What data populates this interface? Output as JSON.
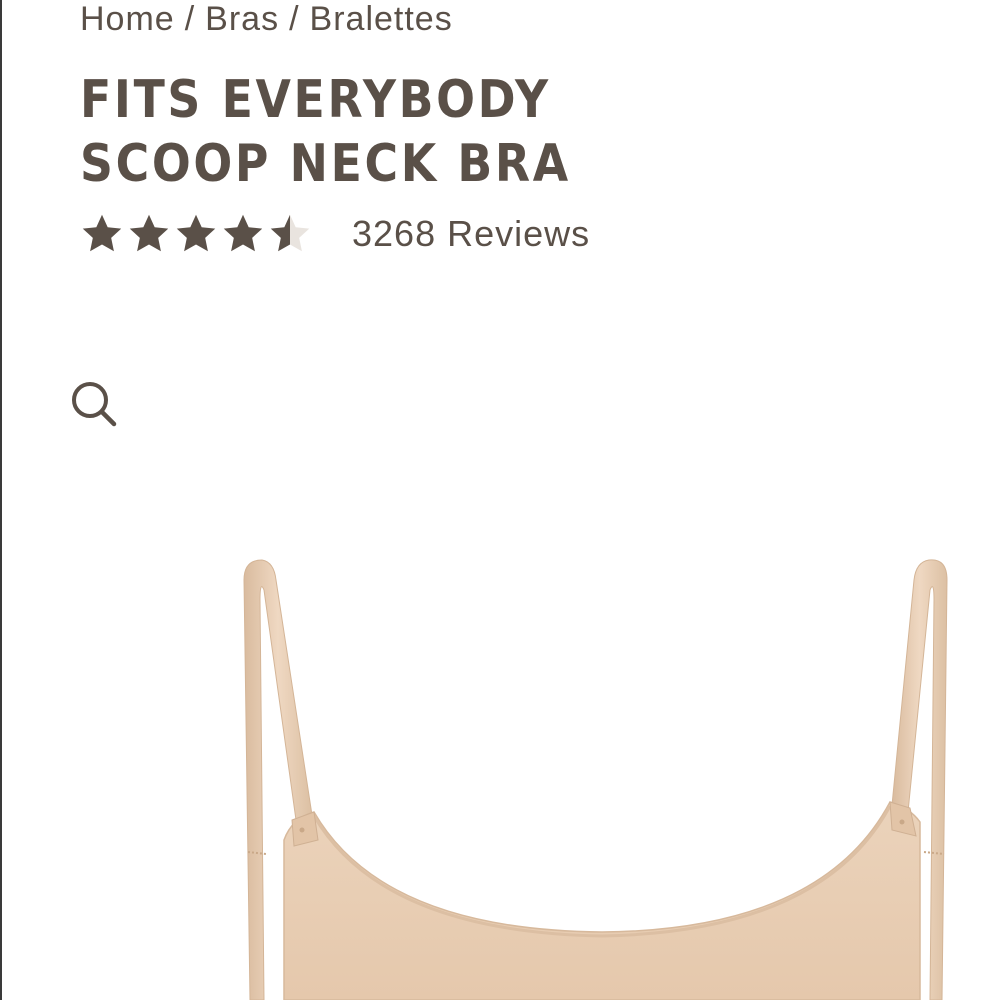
{
  "breadcrumb": {
    "items": [
      "Home",
      "Bras",
      "Bralettes"
    ],
    "separator": "/"
  },
  "product": {
    "title": "FITS EVERYBODY SCOOP NECK BRA",
    "rating": 4.5,
    "rating_max": 5,
    "reviews_text": "3268 Reviews"
  },
  "icons": {
    "zoom": "search-icon",
    "star": "star-icon"
  },
  "colors": {
    "text": "#5a5048",
    "star": "#5a5048",
    "product": "#e8cdb2"
  }
}
